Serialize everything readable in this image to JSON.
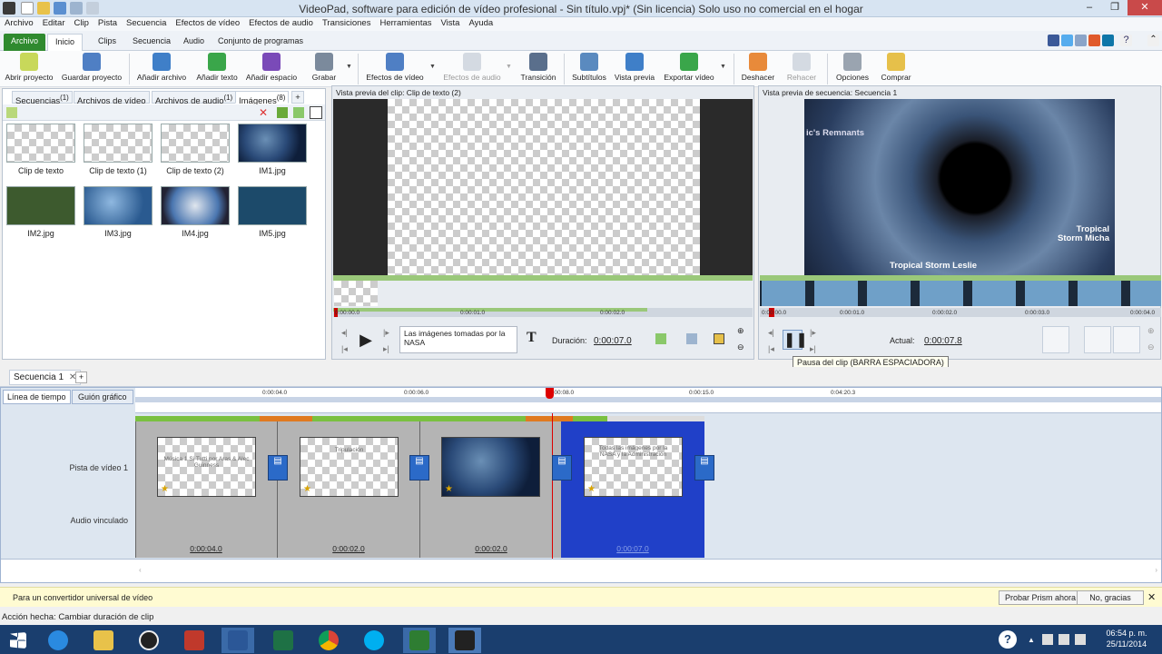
{
  "window": {
    "title": "VideoPad, software para edición de vídeo profesional - Sin título.vpj* (Sin licencia) Solo uso no comercial en el hogar",
    "minimize": "‒",
    "maximize": "❐",
    "close": "✕"
  },
  "menu": [
    "Archivo",
    "Editar",
    "Clip",
    "Pista",
    "Secuencia",
    "Efectos de vídeo",
    "Efectos de audio",
    "Transiciones",
    "Herramientas",
    "Vista",
    "Ayuda"
  ],
  "ribbon_tabs": [
    "Archivo",
    "Inicio",
    "Clips",
    "Secuencia",
    "Audio",
    "Conjunto de programas"
  ],
  "toolbar": {
    "open": "Abrir proyecto",
    "save": "Guardar proyecto",
    "add_file": "Añadir archivo",
    "add_text": "Añadir texto",
    "add_space": "Añadir espacio",
    "record": "Grabar",
    "video_effects": "Efectos de vídeo",
    "audio_effects": "Efectos de audio",
    "transition": "Transición",
    "subtitles": "Subtítulos",
    "preview": "Vista previa",
    "export": "Exportar vídeo",
    "undo": "Deshacer",
    "redo": "Rehacer",
    "options": "Opciones",
    "buy": "Comprar"
  },
  "media_tabs": [
    {
      "label": "Secuencias",
      "count": "(1)"
    },
    {
      "label": "Archivos de vídeo",
      "count": ""
    },
    {
      "label": "Archivos de audio",
      "count": "(1)"
    },
    {
      "label": "Imágenes",
      "count": "(8)"
    }
  ],
  "media_items": [
    "Clip de texto",
    "Clip de texto (1)",
    "Clip de texto (2)",
    "IM1.jpg",
    "IM2.jpg",
    "IM3.jpg",
    "IM4.jpg",
    "IM5.jpg"
  ],
  "clip_preview": {
    "header": "Vista previa del clip: Clip de texto (2)",
    "ticks": [
      "0:00:00.0",
      "0:00:01.0",
      "0:00:02.0"
    ],
    "text_value": "Las imágenes tomadas por la NASA",
    "duration_label": "Duración:",
    "duration_value": "0:00:07.0"
  },
  "seq_preview": {
    "header": "Vista previa de secuencia: Secuencia 1",
    "ticks": [
      "0:00:00.0",
      "0:00:01.0",
      "0:00:02.0",
      "0:00:03.0",
      "0:00:04.0"
    ],
    "overlay_texts": [
      "ic's Remnants",
      "Tropical",
      "Storm Micha",
      "Tropical Storm Leslie"
    ],
    "current_label": "Actual:",
    "current_value": "0:00:07.8",
    "tooltip": "Pausa del clip (BARRA ESPACIADORA)"
  },
  "sequence_tab": "Secuencia 1",
  "timeline": {
    "view_tabs": [
      "Línea de tiempo",
      "Guión gráfico"
    ],
    "ticks": [
      "0:00:04.0",
      "0:00:06.0",
      "0:00:08.0",
      "0:00:15.0",
      "0:04:20.3"
    ],
    "video_track_label": "Pista de vídeo 1",
    "audio_track_label": "Audio vinculado",
    "clip_durations": [
      "0:00:04.0",
      "0:00:02.0",
      "0:00:02.0",
      "0:00:07.0"
    ],
    "clip_texts": [
      "Música 1 Si Tutti por Aras & Alec Guinness",
      "Tripulación",
      "",
      "Todas las imágenes por la NASA y la Administración"
    ]
  },
  "ad_bar": {
    "text": "Para un convertidor universal de vídeo",
    "try_button": "Probar Prism ahora",
    "no_button": "No, gracias",
    "close": "✕"
  },
  "status": "Acción hecha: Cambiar duración de clip",
  "taskbar": {
    "time": "06:54 p. m.",
    "date": "25/11/2014"
  }
}
